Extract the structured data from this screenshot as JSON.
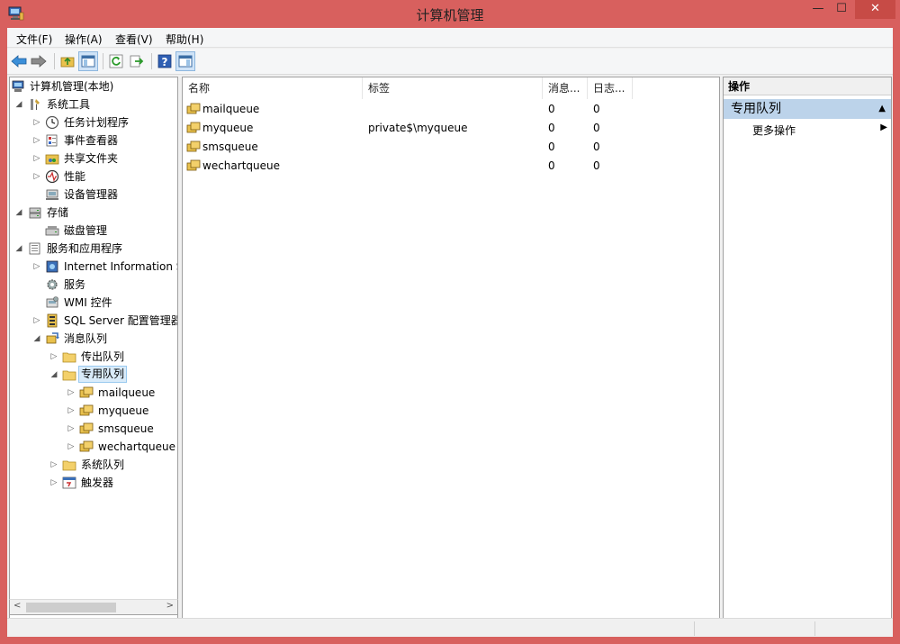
{
  "window": {
    "title": "计算机管理",
    "minimize": "—",
    "maximize": "☐",
    "close": "✕"
  },
  "menu": [
    "文件(F)",
    "操作(A)",
    "查看(V)",
    "帮助(H)"
  ],
  "tree": {
    "root": "计算机管理(本地)",
    "system_tools": "系统工具",
    "task_scheduler": "任务计划程序",
    "event_viewer": "事件查看器",
    "shared_folders": "共享文件夹",
    "performance": "性能",
    "device_manager": "设备管理器",
    "storage": "存储",
    "disk_management": "磁盘管理",
    "services_apps": "服务和应用程序",
    "iis": "Internet Information S",
    "services": "服务",
    "wmi": "WMI 控件",
    "sql_server": "SQL Server 配置管理器",
    "message_queuing": "消息队列",
    "outgoing_queues": "传出队列",
    "private_queues": "专用队列",
    "q_mail": "mailqueue",
    "q_my": "myqueue",
    "q_sms": "smsqueue",
    "q_wechart": "wechartqueue",
    "system_queues": "系统队列",
    "triggers": "触发器"
  },
  "list": {
    "columns": [
      "名称",
      "标签",
      "消息...",
      "日志..."
    ],
    "rows": [
      {
        "name": "mailqueue",
        "label": "",
        "messages": "0",
        "journal": "0"
      },
      {
        "name": "myqueue",
        "label": "private$\\myqueue",
        "messages": "0",
        "journal": "0"
      },
      {
        "name": "smsqueue",
        "label": "",
        "messages": "0",
        "journal": "0"
      },
      {
        "name": "wechartqueue",
        "label": "",
        "messages": "0",
        "journal": "0"
      }
    ]
  },
  "actions": {
    "header": "操作",
    "section": "专用队列",
    "more": "更多操作"
  },
  "colors": {
    "window_frame": "#d8605e",
    "selection": "#d9ebf9",
    "action_section": "#bcd3ea"
  }
}
